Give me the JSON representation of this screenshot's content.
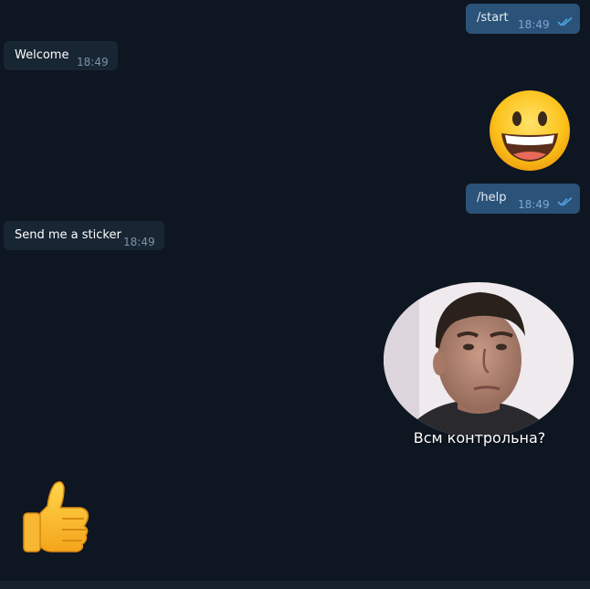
{
  "messages": [
    {
      "direction": "outgoing",
      "text": "/start",
      "time": "18:49",
      "read": true
    },
    {
      "direction": "incoming",
      "text": "Welcome",
      "time": "18:49"
    },
    {
      "direction": "outgoing",
      "sticker": "grinning-face-sticker"
    },
    {
      "direction": "outgoing",
      "text": "/help",
      "time": "18:49",
      "read": true
    },
    {
      "direction": "incoming",
      "text": "Send me a sticker",
      "time": "18:49"
    },
    {
      "direction": "outgoing",
      "video_note": "round-video-note",
      "caption": "Всм контрольна?"
    },
    {
      "direction": "incoming",
      "sticker": "thumbs-up-sticker"
    }
  ],
  "colors": {
    "background": "#0e1621",
    "outgoing_bubble": "#2b5278",
    "incoming_bubble": "#182533",
    "read_ticks": "#4fa3e6"
  }
}
